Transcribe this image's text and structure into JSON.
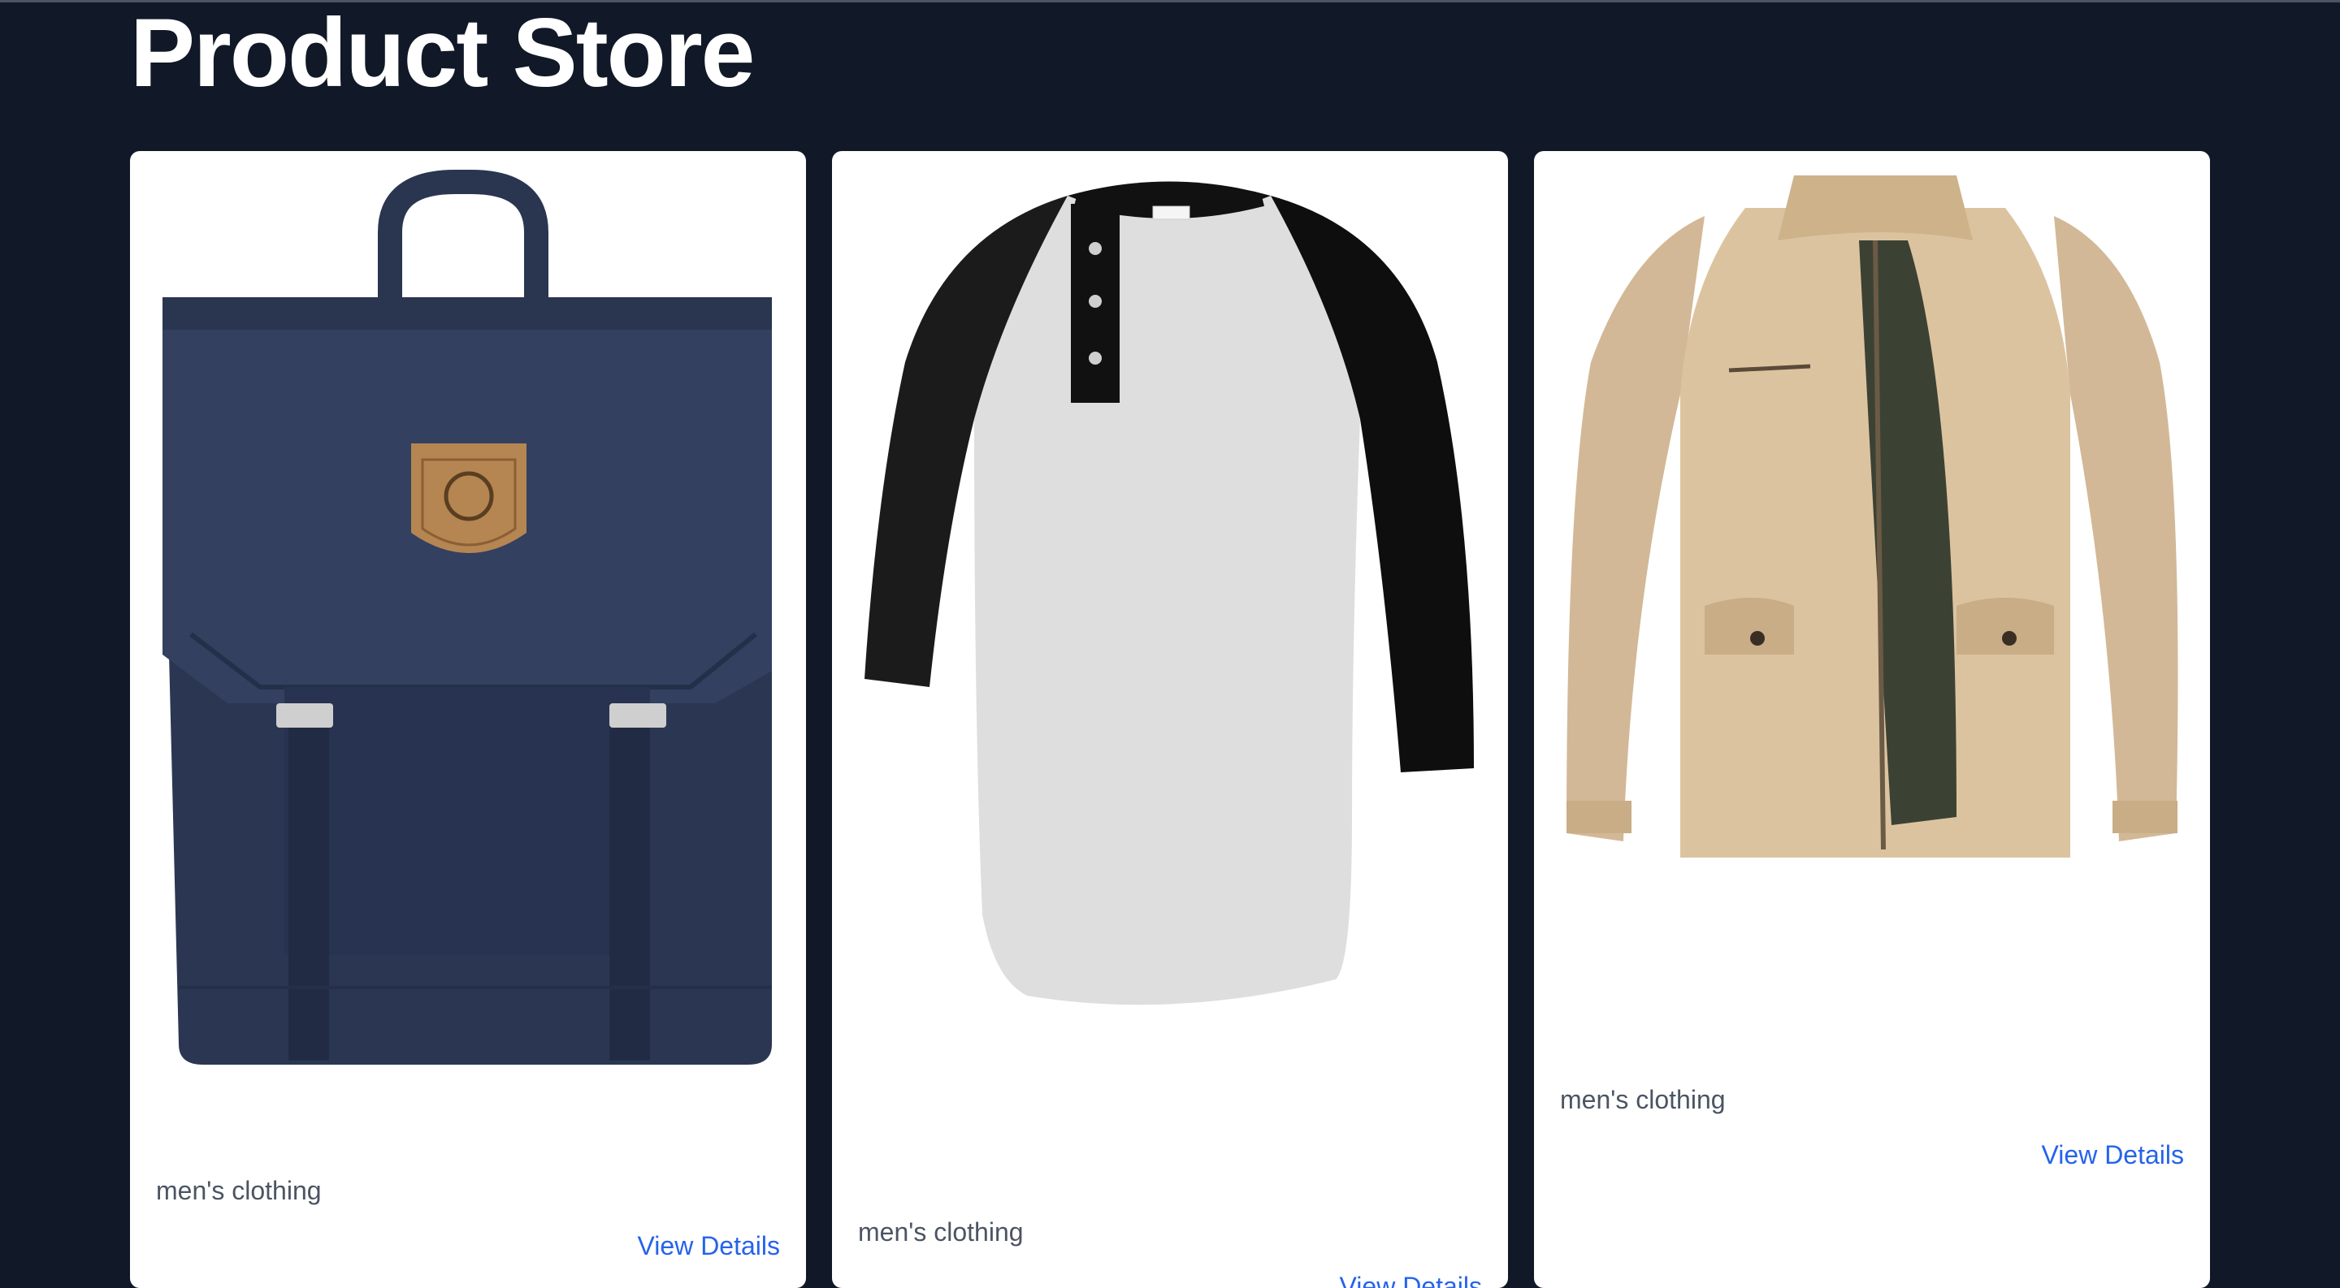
{
  "page": {
    "title": "Product Store"
  },
  "products": [
    {
      "image_alt": "navy backpack",
      "category": "men's clothing",
      "link_label": "View Details"
    },
    {
      "image_alt": "raglan henley t-shirt",
      "category": "men's clothing",
      "link_label": "View Details"
    },
    {
      "image_alt": "khaki jacket",
      "category": "men's clothing",
      "link_label": "View Details"
    }
  ],
  "colors": {
    "background": "#111827",
    "card": "#ffffff",
    "link": "#2563eb",
    "category_text": "#4b5563"
  }
}
